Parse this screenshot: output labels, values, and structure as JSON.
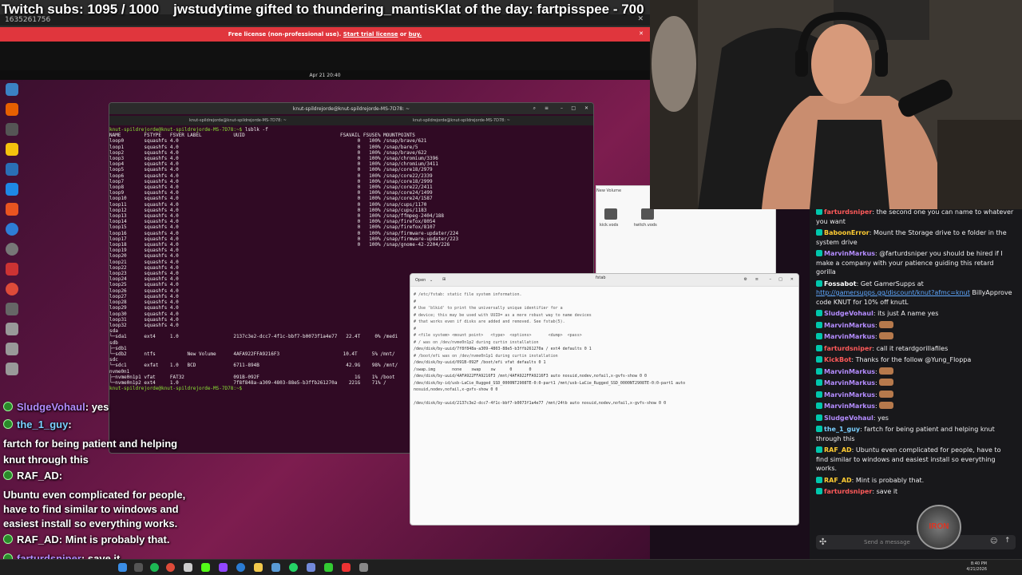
{
  "banner": {
    "subs": "Twitch subs: 1095 / 1000",
    "gifted": "jwstudytime gifted to thundering_mantisKlat of the day: fartpisspee - 700"
  },
  "remote": {
    "title": "1635261756",
    "license_pre": "Free license (non-professional use).",
    "license_trial": "Start trial license",
    "license_or": "or",
    "license_buy": "buy."
  },
  "ubuntu": {
    "clock": "Apr 21 20:40"
  },
  "terminal": {
    "title": "knut-spildrejorde@knut-spildrejorde-MS-7D78: ~",
    "tab_right": "knut-spildrejorde@knut-spildrejorde-MS-7D78: ~",
    "command_prompt": "knut-spildrejorde@knut-spildrejorde-MS-7D78:~$",
    "command": "lsblk -f",
    "header": "NAME        FSTYPE   FSVER LABEL           UUID                                 FSAVAIL FSUSE% MOUNTPOINTS",
    "rows": [
      "loop0       squashfs 4.0                                                              0   100% /snap/brave/621",
      "loop1       squashfs 4.0                                                              0   100% /snap/bare/5",
      "loop2       squashfs 4.0                                                              0   100% /snap/brave/622",
      "loop3       squashfs 4.0                                                              0   100% /snap/chromium/3396",
      "loop4       squashfs 4.0                                                              0   100% /snap/chromium/3411",
      "loop5       squashfs 4.0                                                              0   100% /snap/core18/2979",
      "loop6       squashfs 4.0                                                              0   100% /snap/core22/2339",
      "loop7       squashfs 4.0                                                              0   100% /snap/core18/2999",
      "loop8       squashfs 4.0                                                              0   100% /snap/core22/2411",
      "loop9       squashfs 4.0                                                              0   100% /snap/core24/1499",
      "loop10      squashfs 4.0                                                              0   100% /snap/core24/1587",
      "loop11      squashfs 4.0                                                              0   100% /snap/cups/1170",
      "loop12      squashfs 4.0                                                              0   100% /snap/cups/1183",
      "loop13      squashfs 4.0                                                              0   100% /snap/ffmpeg-2404/188",
      "loop14      squashfs 4.0                                                              0   100% /snap/firefox/8054",
      "loop15      squashfs 4.0                                                              0   100% /snap/firefox/8107",
      "loop16      squashfs 4.0                                                              0   100% /snap/firmware-updater/224",
      "loop17      squashfs 4.0                                                              0   100% /snap/firmware-updater/223",
      "loop18      squashfs 4.0                                                              0   100% /snap/gnome-42-2204/226",
      "loop19      squashfs 4.0",
      "loop20      squashfs 4.0",
      "loop21      squashfs 4.0",
      "loop22      squashfs 4.0",
      "loop23      squashfs 4.0",
      "loop24      squashfs 4.0",
      "loop25      squashfs 4.0",
      "loop26      squashfs 4.0",
      "loop27      squashfs 4.0",
      "loop28      squashfs 4.0",
      "loop29      squashfs 4.0",
      "loop30      squashfs 4.0",
      "loop31      squashfs 4.0",
      "loop32      squashfs 4.0",
      "sda",
      "└─sda1      ext4     1.0                   2137c3e2-dcc7-4f1c-bbf7-b0073f1a4e77   22.4T     0% /medi",
      "sdb",
      "├─sdb1",
      "└─sdb2      ntfs           New Volume      4AFA922FFA9216F3                      10.4T     5% /mnt/",
      "sdc",
      "└─sdc1      exfat    1.0   BCD             6711-894B                              42.9G    98% /mnt/",
      "nvme0n1",
      "├─nvme0n1p1 vfat     FAT32                 091B-092F                                 1G    1% /boot",
      "└─nvme0n1p2 ext4     1.0                   7f8f848a-a309-4803-88e5-b3ffb261270a    221G    71% /"
    ],
    "end_prompt": "knut-spildrejorde@knut-spildrejorde-MS-7D78:~$"
  },
  "files": {
    "title": "New Volume",
    "items": [
      "kick.vods",
      "twitch.vods"
    ]
  },
  "editor": {
    "open_label": "Open",
    "title": "fstab",
    "lines": [
      "# /etc/fstab: static file system information.",
      "#",
      "# Use 'blkid' to print the universally unique identifier for a",
      "# device; this may be used with UUID= as a more robust way to name devices",
      "# that works even if disks are added and removed. See fstab(5).",
      "#",
      "# <file system> <mount point>   <type>  <options>       <dump>  <pass>",
      "# / was on /dev/nvme0n1p2 during curtin installation",
      "/dev/disk/by-uuid/7f8f848a-a309-4803-88e5-b3ffb261270a / ext4 defaults 0 1",
      "# /boot/efi was on /dev/nvme0n1p1 during curtin installation",
      "/dev/disk/by-uuid/091B-092F /boot/efi vfat defaults 0 1",
      "/swap.img       none    swap    sw      0       0",
      "/dev/disk/by-uuid/4AFA922FFA9216F3 /mnt/4AFA922FFA9216F3 auto nosuid,nodev,nofail,x-gvfs-show 0 0",
      "/dev/disk/by-id/usb-LaCie_Rugged_SSD_0000NT2908TE-0:0-part1 /mnt/usb-LaCie_Rugged_SSD_0000NT2908TE-0:0-part1 auto",
      "nosuid,nodev,nofail,x-gvfs-show 0 0",
      "",
      "/dev/disk/by-uuid/2137c3e2-dcc7-4f1c-bbf7-b0073f1a4e77 /mnt/24tb auto nosuid,nodev,nofail,x-gvfs-show 0 0"
    ]
  },
  "taskbar": {
    "time": "8:40 PM",
    "date": "4/21/2026"
  },
  "chat": {
    "messages": [
      {
        "user": "farturdsniper",
        "color": "#ff5a5a",
        "text": "the second one you can name to whatever you want"
      },
      {
        "user": "BaboonError",
        "color": "#ffcc33",
        "text": "Mount the Storage drive to e folder in the system drive"
      },
      {
        "user": "MarvinMarkus",
        "color": "#b48cff",
        "text": "@farturdsniper you should be hired if I make a company with your patience guiding this retard gorilla"
      },
      {
        "user": "Fossabot",
        "color": "#ffffff",
        "text": "Get GamerSupps at",
        "link": "http://gamersupps.gg/discount/knut?afmc=knut",
        "tail": "BillyApprove code KNUT for 10% off knutL"
      },
      {
        "user": "SludgeVohaul",
        "color": "#b48cff",
        "text": "its just A name yes"
      },
      {
        "user": "MarvinMarkus",
        "color": "#b48cff",
        "text": ""
      },
      {
        "user": "MarvinMarkus",
        "color": "#b48cff",
        "text": ""
      },
      {
        "user": "farturdsniper",
        "color": "#ff5a5a",
        "text": "call it retardgorillafiles"
      },
      {
        "user": "KickBot",
        "color": "#ff5a5a",
        "text": "Thanks for the follow @Yung_Floppa"
      },
      {
        "user": "MarvinMarkus",
        "color": "#b48cff",
        "text": ""
      },
      {
        "user": "MarvinMarkus",
        "color": "#b48cff",
        "text": ""
      },
      {
        "user": "MarvinMarkus",
        "color": "#b48cff",
        "text": ""
      },
      {
        "user": "MarvinMarkus",
        "color": "#b48cff",
        "text": ""
      },
      {
        "user": "SludgeVohaul",
        "color": "#b48cff",
        "text": "yes"
      },
      {
        "user": "the_1_guy",
        "color": "#7ad0ff",
        "text": "fartch for being patient and helping knut through this"
      },
      {
        "user": "RAF_AD",
        "color": "#ffcc33",
        "text": "Ubuntu even complicated for people, have to find similar to windows and easiest install so everything works."
      },
      {
        "user": "RAF_AD",
        "color": "#ffcc33",
        "text": "Mint is probably that."
      },
      {
        "user": "farturdsniper",
        "color": "#ff5a5a",
        "text": "save it"
      }
    ],
    "input_placeholder": "Send a message",
    "logo_text": "IRON"
  },
  "overlay": {
    "lines": [
      {
        "name": "SludgeVohaul",
        "sep": ":",
        "text": "yes"
      },
      {
        "name": "the_1_guy",
        "sep": ":",
        "text": ""
      },
      {
        "name": "",
        "sep": "",
        "text": "fartch for being patient and helping"
      },
      {
        "name": "",
        "sep": "",
        "text": "knut through this"
      },
      {
        "name": "RAF_AD",
        "sep": ":",
        "text": ""
      },
      {
        "name": "",
        "sep": "",
        "text": "Ubuntu even complicated for people,"
      },
      {
        "name": "",
        "sep": "",
        "text": "have to find similar to windows and"
      },
      {
        "name": "",
        "sep": "",
        "text": "easiest install so everything works."
      },
      {
        "name": "RAF_AD",
        "sep": ":",
        "text": "Mint is probably that."
      },
      {
        "name": "farturdsniper",
        "sep": ":",
        "text": "save it"
      }
    ]
  },
  "colors": {
    "license_bar": "#e0363d",
    "terminal_bg": "#300a24",
    "chat_bg": "#18181b",
    "accent_green": "#00c7ac"
  }
}
